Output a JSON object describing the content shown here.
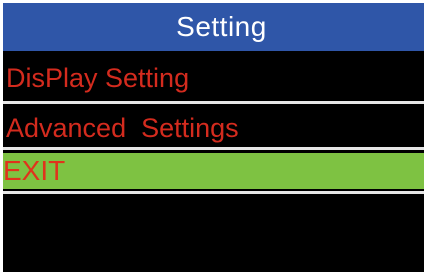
{
  "header": {
    "title": "Setting"
  },
  "menu": {
    "items": [
      {
        "label": "DisPlay Setting",
        "selected": false
      },
      {
        "label": "Advanced  Settings",
        "selected": false
      },
      {
        "label": "EXIT",
        "selected": true
      }
    ]
  },
  "colors": {
    "title_bar": "#2f56a8",
    "title_text": "#ffffff",
    "item_text": "#d42b1e",
    "selected_bg": "#7ec242",
    "screen_bg": "#000000",
    "divider": "#e6e6e6"
  }
}
